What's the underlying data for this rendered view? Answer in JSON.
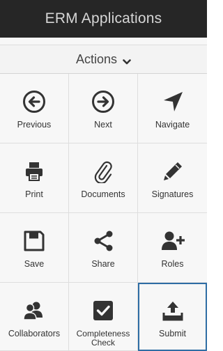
{
  "header": {
    "title": "ERM Applications"
  },
  "actions": {
    "label": "Actions",
    "icon": "chevron-down-icon"
  },
  "tiles": [
    {
      "label": "Previous",
      "icon": "arrow-left-circle-icon"
    },
    {
      "label": "Next",
      "icon": "arrow-right-circle-icon"
    },
    {
      "label": "Navigate",
      "icon": "location-arrow-icon"
    },
    {
      "label": "Print",
      "icon": "printer-icon"
    },
    {
      "label": "Documents",
      "icon": "paperclip-icon"
    },
    {
      "label": "Signatures",
      "icon": "pencil-icon"
    },
    {
      "label": "Save",
      "icon": "floppy-disk-icon"
    },
    {
      "label": "Share",
      "icon": "share-icon"
    },
    {
      "label": "Roles",
      "icon": "user-plus-icon"
    },
    {
      "label": "Collaborators",
      "icon": "users-icon"
    },
    {
      "label": "Completeness Check",
      "icon": "checkbox-icon"
    },
    {
      "label": "Submit",
      "icon": "upload-tray-icon"
    }
  ],
  "colors": {
    "header_bg": "#262626",
    "icon": "#333333",
    "selected_border": "#2e6da4"
  }
}
